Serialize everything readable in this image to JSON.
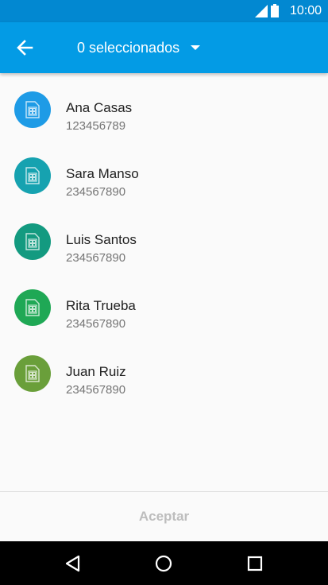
{
  "status_bar": {
    "time": "10:00",
    "icons": [
      "signal-icon",
      "battery-icon"
    ]
  },
  "app_bar": {
    "title": "0 seleccionados",
    "color": "#039be5",
    "icons": [
      "back-arrow-icon",
      "dropdown-caret-icon"
    ]
  },
  "contacts": [
    {
      "name": "Ana Casas",
      "number": "123456789",
      "color": "#1e9be6",
      "icon": "sim-card-icon"
    },
    {
      "name": "Sara Manso",
      "number": "234567890",
      "color": "#16a2b0",
      "icon": "sim-card-icon"
    },
    {
      "name": "Luis Santos",
      "number": "234567890",
      "color": "#139a80",
      "icon": "sim-card-icon"
    },
    {
      "name": "Rita Trueba",
      "number": "234567890",
      "color": "#1fa855",
      "icon": "sim-card-icon"
    },
    {
      "name": "Juan Ruiz",
      "number": "234567890",
      "color": "#6a9f3a",
      "icon": "sim-card-icon"
    }
  ],
  "footer": {
    "accept_label": "Aceptar"
  },
  "nav_bar": {
    "icons": [
      "back-triangle-icon",
      "home-circle-icon",
      "recents-square-icon"
    ]
  }
}
